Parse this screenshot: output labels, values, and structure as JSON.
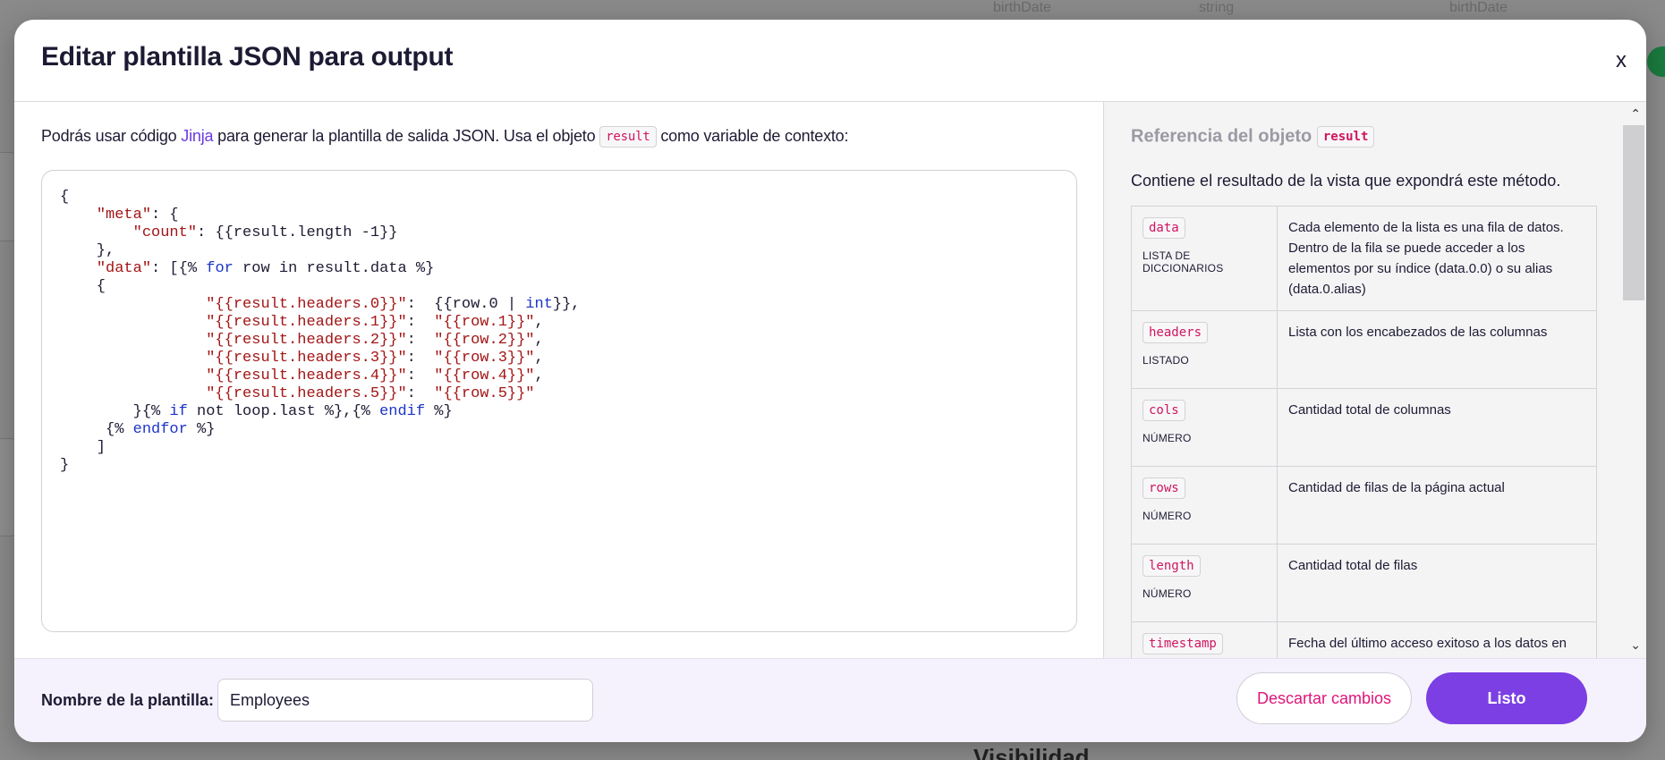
{
  "background": {
    "top_labels": [
      "birthDate",
      "string",
      "birthDate"
    ],
    "bottom_heading": "Visibilidad"
  },
  "modal": {
    "title": "Editar plantilla JSON para output",
    "close_label": "x"
  },
  "editor_pane": {
    "intro_before_link": "Podrás usar código ",
    "intro_link": "Jinja",
    "intro_after_link": " para generar la plantilla de salida JSON. Usa el objeto ",
    "intro_code": "result",
    "intro_end": " como variable de contexto:",
    "code_lines": [
      [
        {
          "t": "{"
        }
      ],
      [
        {
          "t": "    "
        },
        {
          "t": "\"meta\"",
          "c": "s"
        },
        {
          "t": ": {"
        }
      ],
      [
        {
          "t": "        "
        },
        {
          "t": "\"count\"",
          "c": "s"
        },
        {
          "t": ": {{result.length -1}}"
        }
      ],
      [
        {
          "t": "    },"
        }
      ],
      [
        {
          "t": "    "
        },
        {
          "t": "\"data\"",
          "c": "s"
        },
        {
          "t": ": [{% "
        },
        {
          "t": "for",
          "c": "k"
        },
        {
          "t": " row in result.data %}"
        }
      ],
      [
        {
          "t": "    {"
        }
      ],
      [
        {
          "t": "                "
        },
        {
          "t": "\"{{result.headers.0}}\"",
          "c": "s"
        },
        {
          "t": ":  {{row.0 | "
        },
        {
          "t": "int",
          "c": "k"
        },
        {
          "t": "}},"
        }
      ],
      [
        {
          "t": "                "
        },
        {
          "t": "\"{{result.headers.1}}\"",
          "c": "s"
        },
        {
          "t": ":  "
        },
        {
          "t": "\"{{row.1}}\"",
          "c": "s"
        },
        {
          "t": ","
        }
      ],
      [
        {
          "t": "                "
        },
        {
          "t": "\"{{result.headers.2}}\"",
          "c": "s"
        },
        {
          "t": ":  "
        },
        {
          "t": "\"{{row.2}}\"",
          "c": "s"
        },
        {
          "t": ","
        }
      ],
      [
        {
          "t": "                "
        },
        {
          "t": "\"{{result.headers.3}}\"",
          "c": "s"
        },
        {
          "t": ":  "
        },
        {
          "t": "\"{{row.3}}\"",
          "c": "s"
        },
        {
          "t": ","
        }
      ],
      [
        {
          "t": "                "
        },
        {
          "t": "\"{{result.headers.4}}\"",
          "c": "s"
        },
        {
          "t": ":  "
        },
        {
          "t": "\"{{row.4}}\"",
          "c": "s"
        },
        {
          "t": ","
        }
      ],
      [
        {
          "t": "                "
        },
        {
          "t": "\"{{result.headers.5}}\"",
          "c": "s"
        },
        {
          "t": ":  "
        },
        {
          "t": "\"{{row.5}}\"",
          "c": "s"
        }
      ],
      [
        {
          "t": "        }{% "
        },
        {
          "t": "if",
          "c": "k"
        },
        {
          "t": " not loop.last %},{% "
        },
        {
          "t": "endif",
          "c": "k"
        },
        {
          "t": " %}"
        }
      ],
      [
        {
          "t": "     {% "
        },
        {
          "t": "endfor",
          "c": "k"
        },
        {
          "t": " %}"
        }
      ],
      [
        {
          "t": "    ]"
        }
      ],
      [
        {
          "t": "}"
        }
      ]
    ]
  },
  "reference_pane": {
    "title": "Referencia del objeto",
    "title_code": "result",
    "description": "Contiene el resultado de la vista que expondrá este método.",
    "rows": [
      {
        "key": "data",
        "type": "LISTA DE DICCIONARIOS",
        "desc": "Cada elemento de la lista es una fila de datos. Dentro de la fila se puede acceder a los elementos por su índice (data.0.0) o su alias (data.0.alias)"
      },
      {
        "key": "headers",
        "type": "LISTADO",
        "desc": "Lista con los encabezados de las columnas"
      },
      {
        "key": "cols",
        "type": "NÚMERO",
        "desc": "Cantidad total de columnas"
      },
      {
        "key": "rows",
        "type": "NÚMERO",
        "desc": "Cantidad de filas de la página actual"
      },
      {
        "key": "length",
        "type": "NÚMERO",
        "desc": "Cantidad total de filas"
      },
      {
        "key": "timestamp",
        "type": "",
        "desc": "Fecha del último acceso exitoso a los datos en"
      }
    ]
  },
  "footer": {
    "name_label": "Nombre de la plantilla:",
    "name_value": "Employees",
    "discard_label": "Descartar cambios",
    "done_label": "Listo"
  },
  "colors": {
    "accent": "#7b3fe4",
    "discard_text": "#e0157a",
    "code_string": "#a31515",
    "code_keyword": "#1b35c9",
    "inline_code": "#d0155f"
  }
}
